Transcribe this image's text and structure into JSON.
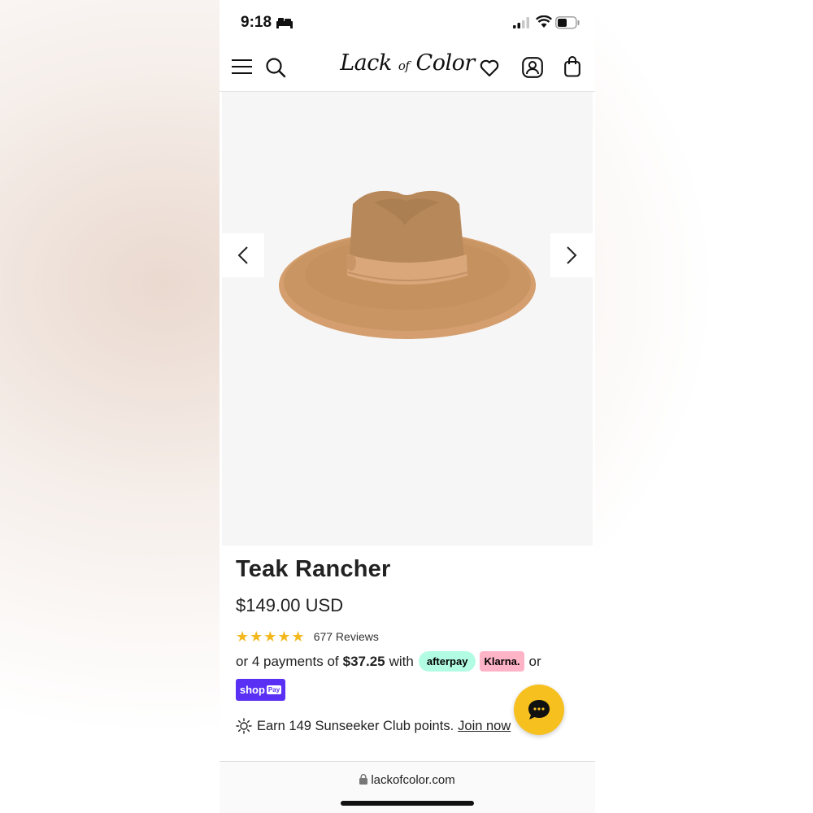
{
  "status_bar": {
    "time": "9:18"
  },
  "header": {
    "logo": {
      "part1": "Lack",
      "part2": "of",
      "part3": "Color"
    }
  },
  "gallery": {
    "image_subject": "tan wide-brim felt rancher hat"
  },
  "product": {
    "title": "Teak Rancher",
    "price": "$149.00 USD",
    "rating": 5,
    "stars": "★★★★★",
    "reviews": "677 Reviews",
    "payments": {
      "prefix": "or 4 payments of",
      "amount": "$37.25",
      "with": "with",
      "afterpay": "afterpay",
      "klarna": "Klarna.",
      "or": "or",
      "shoppay": "shop",
      "shoppay_badge": "Pay"
    },
    "points": {
      "text": "Earn 149 Sunseeker Club points.",
      "link": "Join now"
    }
  },
  "browser": {
    "url": "lackofcolor.com"
  },
  "colors": {
    "star": "#f2b81c",
    "afterpay_bg": "#b2fce4",
    "klarna_bg": "#ffb3c7",
    "shoppay_bg": "#5a31f4",
    "chat_bg": "#f6c01f"
  },
  "icons": [
    "bed-icon",
    "signal-icon",
    "wifi-icon",
    "battery-icon",
    "menu-icon",
    "search-icon",
    "heart-icon",
    "account-icon",
    "bag-icon",
    "chevron-left-icon",
    "chevron-right-icon",
    "sun-icon",
    "chat-icon",
    "lock-icon"
  ]
}
